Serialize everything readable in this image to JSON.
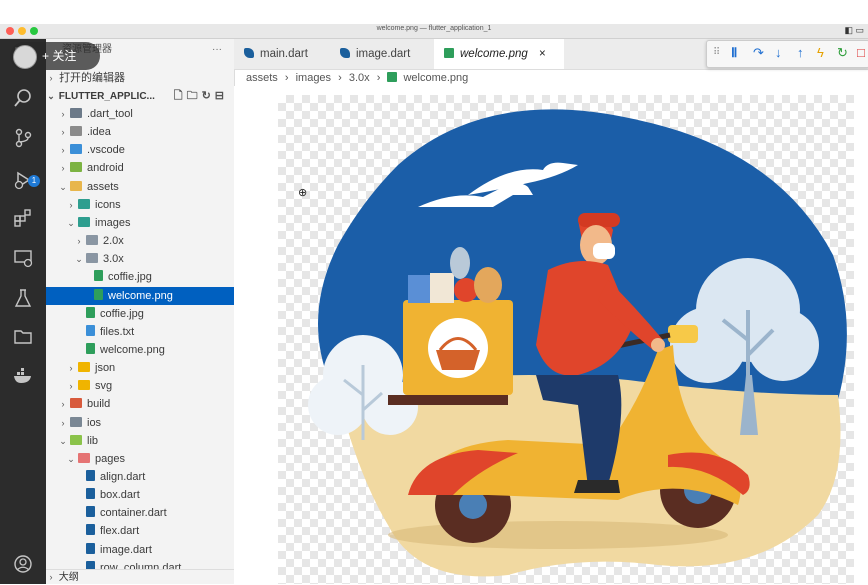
{
  "window": {
    "title": "welcome.png — flutter_application_1"
  },
  "overlay": {
    "follow_label": "+ 关注"
  },
  "sidebar": {
    "explorer_label": "资源管理器",
    "open_editors": "打开的编辑器",
    "workspace": "FLUTTER_APPLIC...",
    "tree": [
      {
        "label": ".dart_tool",
        "chev": "›",
        "depth": 0,
        "icon": "folder-icon",
        "color": "#6c7a89"
      },
      {
        "label": ".idea",
        "chev": "›",
        "depth": 0,
        "icon": "folder-icon",
        "color": "#8b8b8b"
      },
      {
        "label": ".vscode",
        "chev": "›",
        "depth": 0,
        "icon": "folder-icon",
        "color": "#3b8fd8"
      },
      {
        "label": "android",
        "chev": "›",
        "depth": 0,
        "icon": "folder-icon",
        "color": "#7cb342"
      },
      {
        "label": "assets",
        "chev": "⌄",
        "depth": 0,
        "icon": "folder-open-icon",
        "color": "#e8b64c"
      },
      {
        "label": "icons",
        "chev": "›",
        "depth": 1,
        "icon": "folder-icon",
        "color": "#2e9e8f"
      },
      {
        "label": "images",
        "chev": "⌄",
        "depth": 1,
        "icon": "folder-open-icon",
        "color": "#2e9e8f"
      },
      {
        "label": "2.0x",
        "chev": "›",
        "depth": 2,
        "icon": "folder-icon",
        "color": "#8a96a3"
      },
      {
        "label": "3.0x",
        "chev": "⌄",
        "depth": 2,
        "icon": "folder-open-icon",
        "color": "#8a96a3"
      },
      {
        "label": "coffie.jpg",
        "chev": "",
        "depth": 3,
        "icon": "image-file-icon",
        "color": "#2e9e5b"
      },
      {
        "label": "welcome.png",
        "chev": "",
        "depth": 3,
        "icon": "image-file-icon",
        "color": "#2e9e5b",
        "selected": true
      },
      {
        "label": "coffie.jpg",
        "chev": "",
        "depth": 2,
        "icon": "image-file-icon",
        "color": "#2e9e5b"
      },
      {
        "label": "files.txt",
        "chev": "",
        "depth": 2,
        "icon": "text-file-icon",
        "color": "#3b8fd8"
      },
      {
        "label": "welcome.png",
        "chev": "",
        "depth": 2,
        "icon": "image-file-icon",
        "color": "#2e9e5b"
      },
      {
        "label": "json",
        "chev": "›",
        "depth": 1,
        "icon": "folder-icon",
        "color": "#f0b400"
      },
      {
        "label": "svg",
        "chev": "›",
        "depth": 1,
        "icon": "folder-icon",
        "color": "#f0b400"
      },
      {
        "label": "build",
        "chev": "›",
        "depth": 0,
        "icon": "folder-icon",
        "color": "#d85a3c"
      },
      {
        "label": "ios",
        "chev": "›",
        "depth": 0,
        "icon": "folder-icon",
        "color": "#7a8794"
      },
      {
        "label": "lib",
        "chev": "⌄",
        "depth": 0,
        "icon": "folder-open-icon",
        "color": "#8bc34a"
      },
      {
        "label": "pages",
        "chev": "⌄",
        "depth": 1,
        "icon": "folder-open-icon",
        "color": "#e57373"
      },
      {
        "label": "align.dart",
        "chev": "",
        "depth": 2,
        "icon": "dart-file-icon",
        "color": "#1b5f9c"
      },
      {
        "label": "box.dart",
        "chev": "",
        "depth": 2,
        "icon": "dart-file-icon",
        "color": "#1b5f9c"
      },
      {
        "label": "container.dart",
        "chev": "",
        "depth": 2,
        "icon": "dart-file-icon",
        "color": "#1b5f9c"
      },
      {
        "label": "flex.dart",
        "chev": "",
        "depth": 2,
        "icon": "dart-file-icon",
        "color": "#1b5f9c"
      },
      {
        "label": "image.dart",
        "chev": "",
        "depth": 2,
        "icon": "dart-file-icon",
        "color": "#1b5f9c"
      },
      {
        "label": "row_column.dart",
        "chev": "",
        "depth": 2,
        "icon": "dart-file-icon",
        "color": "#1b5f9c"
      }
    ],
    "outline_label": "大纲"
  },
  "tabs": [
    {
      "label": "main.dart",
      "icon": "dart-file-icon"
    },
    {
      "label": "image.dart",
      "icon": "dart-file-icon"
    },
    {
      "label": "welcome.png",
      "icon": "image-file-icon",
      "active": true,
      "close": "×"
    }
  ],
  "breadcrumb": {
    "items": [
      "assets",
      "images",
      "3.0x",
      "welcome.png"
    ],
    "sep": "›"
  },
  "activity_badge": "1",
  "colors": {
    "accent": "#0060c0",
    "illustration_blue": "#1b5ea8",
    "scooter_yellow": "#f0b332",
    "shirt_red": "#e0452b"
  }
}
